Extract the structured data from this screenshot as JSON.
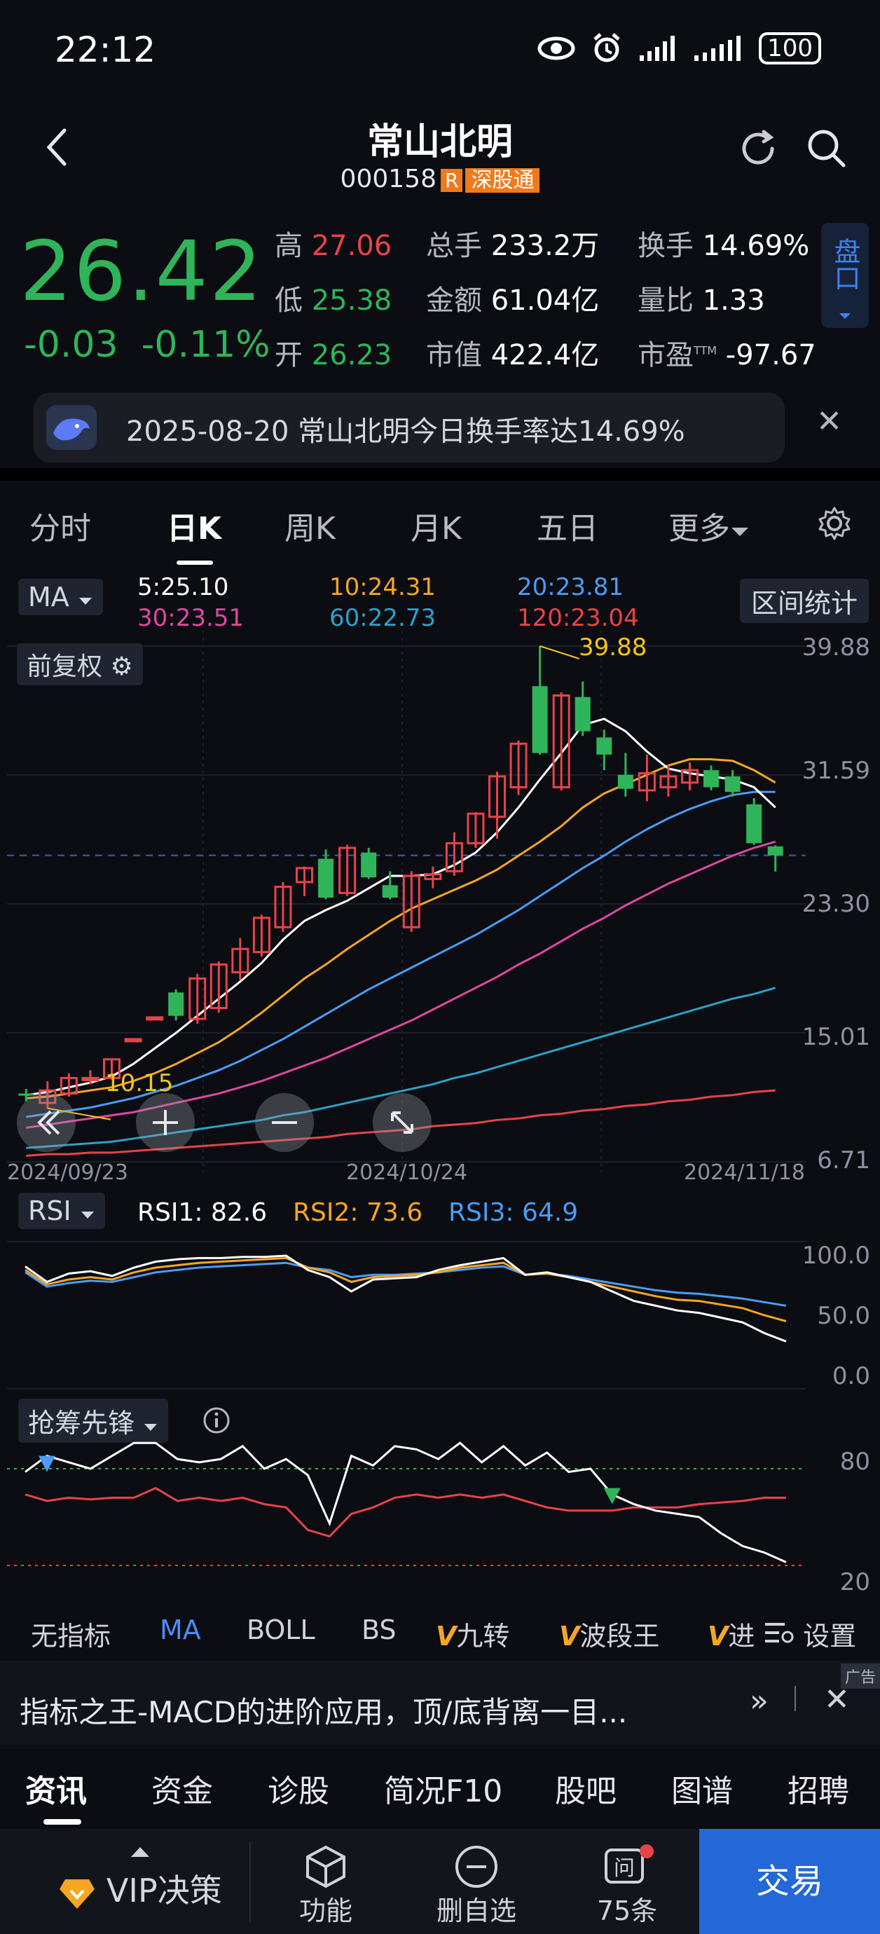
{
  "status": {
    "time": "22:12",
    "battery": "100"
  },
  "header": {
    "name": "常山北明",
    "code": "000158",
    "tag_r": "R",
    "tag_market": "深股通"
  },
  "quote": {
    "price": "26.42",
    "change": "-0.03",
    "change_pct": "-0.11%",
    "high_label": "高",
    "high": "27.06",
    "low_label": "低",
    "low": "25.38",
    "open_label": "开",
    "open": "26.23",
    "vol_label": "总手",
    "vol": "233.2万",
    "amount_label": "金额",
    "amount": "61.04亿",
    "mcap_label": "市值",
    "mcap": "422.4亿",
    "turnover_label": "换手",
    "turnover": "14.69%",
    "vratio_label": "量比",
    "vratio": "1.33",
    "pe_label": "市盈",
    "pe_sup": "TTM",
    "pe": "-97.67",
    "panel_btn": "盘口"
  },
  "news": {
    "text": "2025-08-20 常山北明今日换手率达14.69%"
  },
  "tabs": [
    "分时",
    "日K",
    "周K",
    "月K",
    "五日",
    "更多"
  ],
  "ma": {
    "selector": "MA",
    "ma5": "5:25.10",
    "ma10": "10:24.31",
    "ma20": "20:23.81",
    "ma30": "30:23.51",
    "ma60": "60:22.73",
    "ma120": "120:23.04",
    "interval_btn": "区间统计",
    "adjust_btn": "前复权"
  },
  "chart_axis": {
    "y_ticks": [
      "39.88",
      "31.59",
      "23.30",
      "15.01",
      "6.71"
    ],
    "x_ticks": [
      "2024/09/23",
      "2024/10/24",
      "2024/11/18"
    ],
    "max_label": "39.88",
    "min_label": "10.15"
  },
  "rsi": {
    "selector": "RSI",
    "rsi1": "RSI1: 82.6",
    "rsi2": "RSI2: 73.6",
    "rsi3": "RSI3: 64.9",
    "ticks": [
      "100.0",
      "50.0",
      "0.0"
    ]
  },
  "chip": {
    "selector": "抢筹先锋",
    "ticks": [
      "80",
      "20"
    ]
  },
  "indicator_tabs": [
    "无指标",
    "MA",
    "BOLL",
    "BS",
    "九转",
    "波段王",
    "进",
    "设置"
  ],
  "ad": {
    "text": "指标之王-MACD的进阶应用，顶/底背离一目...",
    "tag": "广告"
  },
  "news_tabs": [
    "资讯",
    "资金",
    "诊股",
    "简况F10",
    "股吧",
    "图谱",
    "招聘"
  ],
  "bottom": {
    "vip": "VIP决策",
    "func": "功能",
    "remove": "删自选",
    "msgs": "75条",
    "trade": "交易"
  },
  "colors": {
    "up": "#e8434a",
    "down": "#2fb45a",
    "ma5": "#ffffff",
    "ma10": "#f5a623",
    "ma20": "#4b9cf5",
    "ma30": "#e0479e",
    "ma60": "#2aa2c8",
    "ma120": "#e8434a"
  },
  "chart_data": {
    "type": "candlestick",
    "y_range": [
      6.71,
      39.88
    ],
    "x_range": [
      "2024/09/23",
      "2024/11/18"
    ],
    "candles": [
      {
        "o": 11.1,
        "c": 11.0,
        "h": 11.4,
        "l": 10.6
      },
      {
        "o": 10.5,
        "c": 11.3,
        "h": 11.9,
        "l": 10.15
      },
      {
        "o": 11.1,
        "c": 12.1,
        "h": 12.4,
        "l": 10.9
      },
      {
        "o": 12.0,
        "c": 12.1,
        "h": 12.6,
        "l": 11.7
      },
      {
        "o": 12.1,
        "c": 13.3,
        "h": 13.3,
        "l": 12.0
      },
      {
        "o": 14.6,
        "c": 14.6,
        "h": 14.6,
        "l": 14.6
      },
      {
        "o": 16.0,
        "c": 16.0,
        "h": 16.0,
        "l": 16.0
      },
      {
        "o": 17.6,
        "c": 16.1,
        "h": 17.8,
        "l": 15.8
      },
      {
        "o": 15.9,
        "c": 18.5,
        "h": 18.8,
        "l": 15.6
      },
      {
        "o": 16.6,
        "c": 19.4,
        "h": 19.6,
        "l": 16.3
      },
      {
        "o": 18.9,
        "c": 20.4,
        "h": 21.1,
        "l": 18.4
      },
      {
        "o": 20.2,
        "c": 22.4,
        "h": 22.6,
        "l": 19.9
      },
      {
        "o": 21.8,
        "c": 24.4,
        "h": 24.7,
        "l": 21.5
      },
      {
        "o": 24.7,
        "c": 25.6,
        "h": 25.7,
        "l": 23.8
      },
      {
        "o": 26.2,
        "c": 23.7,
        "h": 26.8,
        "l": 23.6
      },
      {
        "o": 24.0,
        "c": 26.9,
        "h": 27.1,
        "l": 23.8
      },
      {
        "o": 26.6,
        "c": 25.0,
        "h": 26.9,
        "l": 24.9
      },
      {
        "o": 24.5,
        "c": 23.7,
        "h": 25.4,
        "l": 23.6
      },
      {
        "o": 21.8,
        "c": 25.1,
        "h": 25.4,
        "l": 21.5
      },
      {
        "o": 24.9,
        "c": 25.2,
        "h": 25.7,
        "l": 24.3
      },
      {
        "o": 25.4,
        "c": 27.2,
        "h": 27.9,
        "l": 25.1
      },
      {
        "o": 27.2,
        "c": 29.1,
        "h": 29.2,
        "l": 26.9
      },
      {
        "o": 28.9,
        "c": 31.5,
        "h": 31.8,
        "l": 27.5
      },
      {
        "o": 30.8,
        "c": 33.6,
        "h": 33.8,
        "l": 30.3
      },
      {
        "o": 37.3,
        "c": 33.0,
        "h": 39.88,
        "l": 32.9
      },
      {
        "o": 30.8,
        "c": 36.7,
        "h": 36.9,
        "l": 30.6
      },
      {
        "o": 36.6,
        "c": 34.4,
        "h": 37.6,
        "l": 34.1
      },
      {
        "o": 34.0,
        "c": 32.9,
        "h": 34.5,
        "l": 31.9
      },
      {
        "o": 31.6,
        "c": 30.7,
        "h": 33.0,
        "l": 30.2
      },
      {
        "o": 30.6,
        "c": 31.7,
        "h": 32.9,
        "l": 29.9
      },
      {
        "o": 30.8,
        "c": 31.5,
        "h": 32.2,
        "l": 30.2
      },
      {
        "o": 31.1,
        "c": 31.9,
        "h": 32.4,
        "l": 30.6
      },
      {
        "o": 31.9,
        "c": 30.8,
        "h": 32.2,
        "l": 30.6
      },
      {
        "o": 31.5,
        "c": 30.5,
        "h": 31.9,
        "l": 30.2
      },
      {
        "o": 29.7,
        "c": 27.2,
        "h": 30.1,
        "l": 27.1
      },
      {
        "o": 27.0,
        "c": 26.42,
        "h": 27.06,
        "l": 25.38
      }
    ],
    "ma5": [
      11.0,
      11.2,
      11.5,
      11.8,
      12.2,
      13.0,
      14.0,
      15.0,
      16.1,
      17.2,
      18.3,
      19.5,
      21.0,
      22.2,
      22.9,
      23.5,
      24.3,
      25.1,
      25.1,
      25.2,
      25.8,
      26.6,
      27.9,
      29.5,
      31.3,
      33.0,
      34.8,
      35.2,
      34.4,
      33.1,
      32.0,
      31.7,
      31.5,
      31.3,
      30.8,
      29.5
    ],
    "ma10": [
      10.8,
      10.9,
      11.1,
      11.3,
      11.5,
      11.9,
      12.4,
      13.0,
      13.7,
      14.4,
      15.3,
      16.3,
      17.4,
      18.5,
      19.4,
      20.4,
      21.3,
      22.2,
      23.0,
      23.6,
      24.2,
      24.8,
      25.5,
      26.4,
      27.3,
      28.3,
      29.5,
      30.4,
      31.0,
      31.6,
      32.2,
      32.6,
      32.6,
      32.5,
      31.9,
      31.1
    ],
    "ma20": [
      9.6,
      9.8,
      10.0,
      10.2,
      10.5,
      10.8,
      11.2,
      11.6,
      12.1,
      12.6,
      13.2,
      13.9,
      14.6,
      15.4,
      16.2,
      17.0,
      17.8,
      18.5,
      19.2,
      19.9,
      20.6,
      21.3,
      22.1,
      22.9,
      23.8,
      24.7,
      25.6,
      26.4,
      27.3,
      28.1,
      28.8,
      29.4,
      29.9,
      30.3,
      30.5,
      30.5
    ],
    "ma30": [
      8.9,
      9.1,
      9.3,
      9.5,
      9.7,
      9.9,
      10.2,
      10.5,
      10.8,
      11.1,
      11.5,
      11.9,
      12.4,
      12.9,
      13.4,
      14.0,
      14.6,
      15.2,
      15.8,
      16.5,
      17.2,
      17.9,
      18.6,
      19.4,
      20.1,
      20.9,
      21.7,
      22.4,
      23.2,
      23.9,
      24.6,
      25.2,
      25.8,
      26.4,
      26.9,
      27.3
    ],
    "ma60": [
      7.6,
      7.7,
      7.8,
      7.9,
      8.0,
      8.2,
      8.4,
      8.6,
      8.8,
      9.0,
      9.2,
      9.4,
      9.7,
      9.9,
      10.2,
      10.5,
      10.8,
      11.1,
      11.4,
      11.7,
      12.1,
      12.4,
      12.8,
      13.2,
      13.6,
      14.0,
      14.4,
      14.8,
      15.2,
      15.6,
      16.0,
      16.4,
      16.8,
      17.2,
      17.5,
      17.9
    ],
    "ma120": [
      7.1,
      7.2,
      7.2,
      7.3,
      7.3,
      7.4,
      7.5,
      7.6,
      7.7,
      7.8,
      7.9,
      8.0,
      8.1,
      8.2,
      8.3,
      8.5,
      8.6,
      8.7,
      8.8,
      9.0,
      9.1,
      9.2,
      9.4,
      9.5,
      9.7,
      9.8,
      10.0,
      10.1,
      10.3,
      10.4,
      10.6,
      10.7,
      10.9,
      11.0,
      11.2,
      11.3
    ],
    "rsi_series": [
      {
        "name": "RSI1",
        "values": [
          91,
          78,
          85,
          87,
          83,
          90,
          95,
          97,
          98,
          98,
          99,
          99,
          100,
          88,
          82,
          70,
          80,
          81,
          82,
          88,
          92,
          95,
          98,
          84,
          86,
          82,
          78,
          70,
          62,
          58,
          54,
          52,
          48,
          44,
          35,
          28
        ]
      },
      {
        "name": "RSI2",
        "values": [
          88,
          76,
          80,
          82,
          80,
          86,
          90,
          92,
          94,
          95,
          96,
          97,
          98,
          90,
          86,
          78,
          82,
          83,
          84,
          86,
          90,
          92,
          94,
          84,
          85,
          82,
          78,
          74,
          70,
          66,
          63,
          62,
          59,
          56,
          50,
          45
        ]
      },
      {
        "name": "RSI3",
        "values": [
          86,
          74,
          77,
          79,
          78,
          82,
          86,
          88,
          90,
          91,
          92,
          93,
          94,
          90,
          88,
          82,
          84,
          84,
          85,
          86,
          88,
          90,
          91,
          84,
          85,
          83,
          80,
          77,
          74,
          71,
          69,
          68,
          66,
          64,
          61,
          58
        ]
      }
    ],
    "chip_series": [
      {
        "name": "white",
        "values": [
          78,
          88,
          84,
          80,
          88,
          96,
          96,
          86,
          84,
          86,
          94,
          80,
          86,
          76,
          46,
          88,
          82,
          94,
          92,
          86,
          96,
          84,
          94,
          82,
          90,
          78,
          80,
          64,
          58,
          54,
          52,
          50,
          40,
          32,
          28,
          22
        ]
      },
      {
        "name": "red",
        "values": [
          64,
          60,
          62,
          61,
          62,
          62,
          68,
          60,
          62,
          60,
          62,
          58,
          56,
          42,
          38,
          52,
          56,
          62,
          64,
          62,
          64,
          62,
          64,
          60,
          56,
          54,
          54,
          54,
          56,
          56,
          56,
          58,
          59,
          60,
          62,
          62
        ]
      }
    ]
  }
}
